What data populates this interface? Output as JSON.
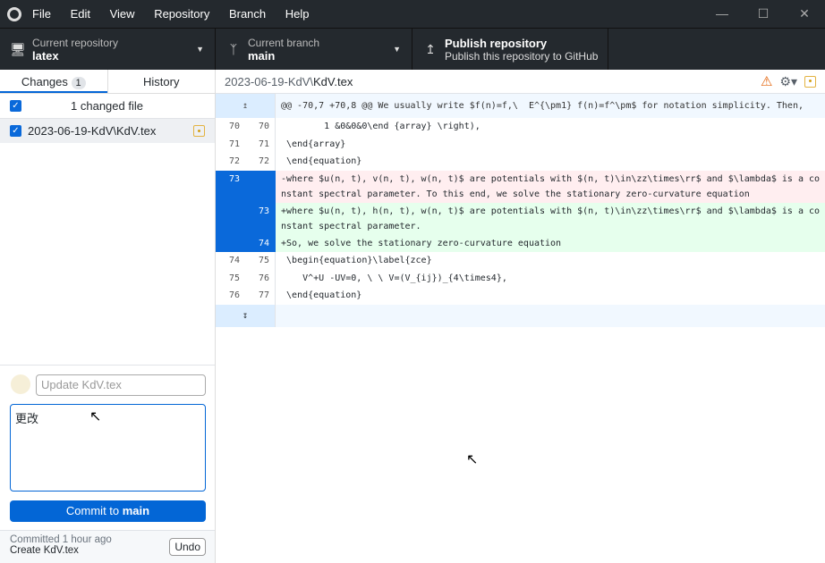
{
  "menu": [
    "File",
    "Edit",
    "View",
    "Repository",
    "Branch",
    "Help"
  ],
  "toolbar": {
    "repo": {
      "label": "Current repository",
      "value": "latex"
    },
    "branch": {
      "label": "Current branch",
      "value": "main"
    },
    "publish": {
      "label": "Publish repository",
      "desc": "Publish this repository to GitHub"
    }
  },
  "tabs": {
    "changes": "Changes",
    "changes_count": "1",
    "history": "History"
  },
  "changes": {
    "header": "1 changed file",
    "files": [
      {
        "path": "2023-06-19-KdV\\KdV.tex",
        "status": "modified",
        "checked": true
      }
    ]
  },
  "commit": {
    "summary_placeholder": "Update KdV.tex",
    "description": "更改",
    "button_prefix": "Commit to ",
    "button_branch": "main"
  },
  "last_commit": {
    "time": "Committed 1 hour ago",
    "message": "Create KdV.tex",
    "undo": "Undo"
  },
  "diff": {
    "dir": "2023-06-19-KdV\\",
    "file": "KdV.tex",
    "hunk": "@@ -70,7 +70,8 @@ We usually write $f(n)=f,\\  E^{\\pm1} f(n)=f^\\pm$ for notation simplicity. Then,",
    "lines": [
      {
        "old": "70",
        "new": "70",
        "type": "ctx",
        "text": "        1 &0&0&0\\end {array} \\right),"
      },
      {
        "old": "71",
        "new": "71",
        "type": "ctx",
        "text": " \\end{array}"
      },
      {
        "old": "72",
        "new": "72",
        "type": "ctx",
        "text": " \\end{equation}"
      },
      {
        "old": "73",
        "new": "",
        "type": "del",
        "text": "-where $u(n, t), v(n, t), w(n, t)$ are potentials with $(n, t)\\in\\zz\\times\\rr$ and $\\lambda$ is a constant spectral parameter. To this end, we solve the stationary zero-curvature equation"
      },
      {
        "old": "",
        "new": "73",
        "type": "add",
        "text": "+where $u(n, t), h(n, t), w(n, t)$ are potentials with $(n, t)\\in\\zz\\times\\rr$ and $\\lambda$ is a constant spectral parameter."
      },
      {
        "old": "",
        "new": "74",
        "type": "add",
        "text": "+So, we solve the stationary zero-curvature equation"
      },
      {
        "old": "74",
        "new": "75",
        "type": "ctx",
        "text": " \\begin{equation}\\label{zce}"
      },
      {
        "old": "75",
        "new": "76",
        "type": "ctx",
        "text": "    V^+U -UV=0, \\ \\ V=(V_{ij})_{4\\times4},"
      },
      {
        "old": "76",
        "new": "77",
        "type": "ctx",
        "text": " \\end{equation}"
      }
    ]
  },
  "colors": {
    "accent": "#0366d6",
    "toolbar": "#24292e",
    "deleted": "#ffeef0",
    "added": "#e6ffed",
    "modified": "#e3b341"
  }
}
